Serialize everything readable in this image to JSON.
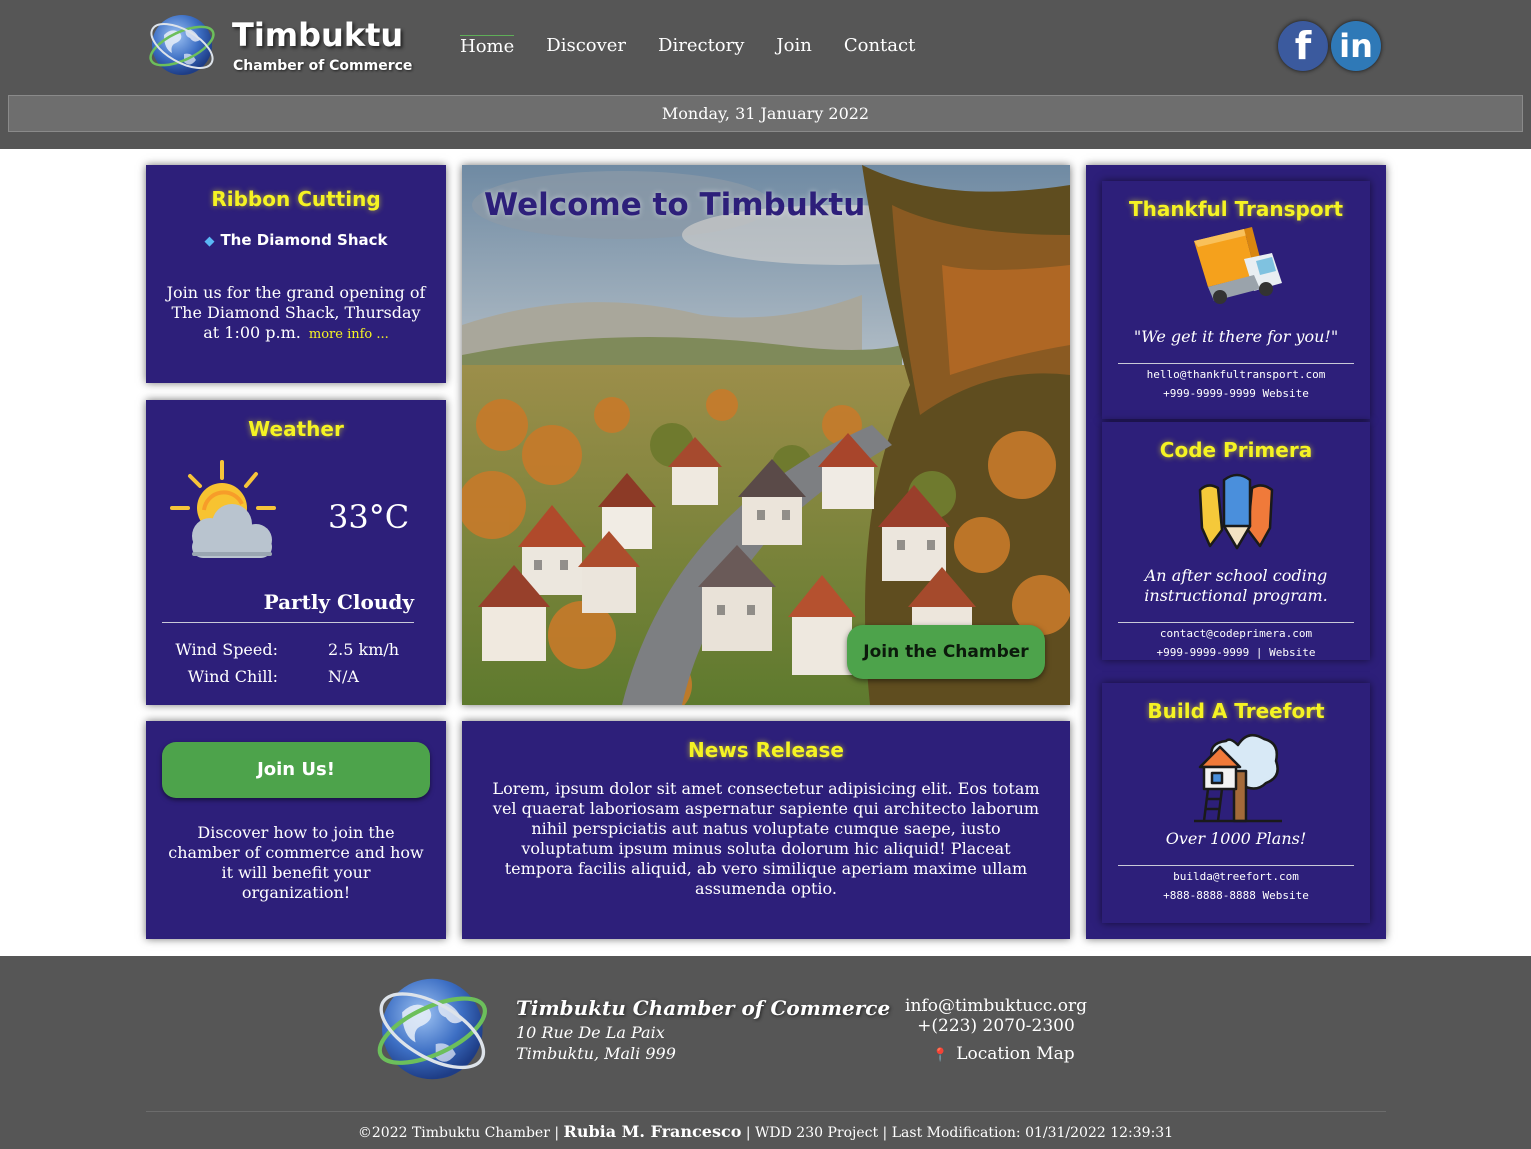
{
  "header": {
    "brand_name": "Timbuktu",
    "brand_sub": "Chamber of Commerce",
    "nav": [
      "Home",
      "Discover",
      "Directory",
      "Join",
      "Contact"
    ],
    "active_nav": "Home",
    "social": {
      "facebook": "f",
      "linkedin": "in"
    },
    "date": "Monday, 31 January 2022"
  },
  "ribbon": {
    "title": "Ribbon Cutting",
    "business": "The Diamond Shack",
    "icon": "diamond-icon",
    "description": "Join us for the grand opening of The Diamond Shack, Thursday at 1:00 p.m.",
    "more_link": "more info ..."
  },
  "weather": {
    "title": "Weather",
    "icon": "partly-cloudy-icon",
    "temperature": "33°C",
    "condition": "Partly Cloudy",
    "wind_speed_label": "Wind Speed:",
    "wind_speed": "2.5 km/h",
    "wind_chill_label": "Wind Chill:",
    "wind_chill": "N/A"
  },
  "join_us": {
    "button": "Join Us!",
    "description": "Discover how to join the chamber of commerce and how it will benefit your organization!"
  },
  "hero": {
    "title": "Welcome to Timbuktu",
    "button": "Join the Chamber"
  },
  "news": {
    "title": "News Release",
    "body": "Lorem, ipsum dolor sit amet consectetur adipisicing elit. Eos totam vel quaerat laboriosam aspernatur sapiente qui architecto laborum nihil perspiciatis aut natus voluptate cumque saepe, iusto voluptatum ipsum minus soluta dolorum hic aliquid! Placeat tempora facilis aliquid, ab vero similique aperiam maxime ullam assumenda optio."
  },
  "spotlights": [
    {
      "title": "Thankful Transport",
      "icon": "truck-icon",
      "tagline": "\"We get it there for you!\"",
      "email": "hello@thankfultransport.com",
      "contact_line": "+999-9999-9999 Website"
    },
    {
      "title": "Code Primera",
      "icon": "pencils-icon",
      "tagline": "An after school coding instructional program.",
      "email": "contact@codeprimera.com",
      "contact_line": "+999-9999-9999 | Website"
    },
    {
      "title": "Build A Treefort",
      "icon": "treehouse-icon",
      "tagline": "Over 1000 Plans!",
      "email": "builda@treefort.com",
      "contact_line": "+888-8888-8888 Website"
    }
  ],
  "footer": {
    "org": "Timbuktu Chamber of Commerce",
    "address_1": "10 Rue De La Paix",
    "address_2": "Timbuktu, Mali 999",
    "email": "info@timbuktucc.org",
    "phone": "+(223) 2070-2300",
    "map_link": "Location Map",
    "copyright": "©2022 Timbuktu Chamber",
    "author": "Rubia M. Francesco",
    "project": "WDD 230 Project",
    "last_modified": "Last Modification: 01/31/2022 12:39:31"
  },
  "colors": {
    "header_bg": "#565656",
    "card_bg": "#2d1f7a",
    "title_yellow": "#f5f323",
    "button_green": "#4da34b"
  }
}
